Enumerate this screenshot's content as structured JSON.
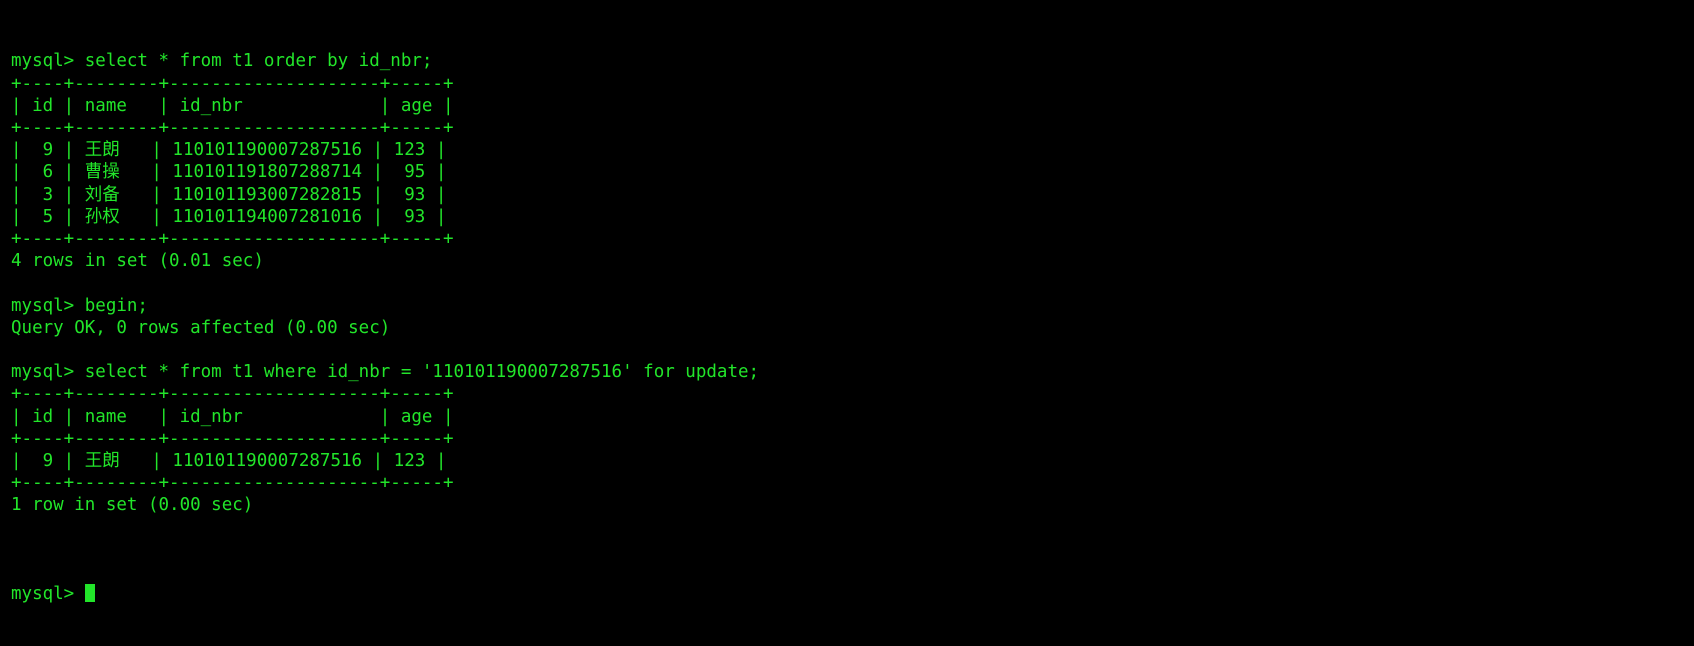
{
  "terminal": {
    "app": "mysql-client",
    "foreground_color": "#22e52a",
    "background_color": "#000000",
    "prompt": "mysql> ",
    "cursor": "block-cursor"
  },
  "lines": [
    {
      "id": "cmd-1",
      "text": "mysql> select * from t1 order by id_nbr;"
    },
    {
      "id": "t1-sep-top",
      "text": "+----+--------+--------------------+-----+"
    },
    {
      "id": "t1-header",
      "text": "| id | name   | id_nbr             | age |"
    },
    {
      "id": "t1-sep-mid",
      "text": "+----+--------+--------------------+-----+"
    },
    {
      "id": "t1-row-1",
      "text": "|  9 | 王朗   | 110101190007287516 | 123 |"
    },
    {
      "id": "t1-row-2",
      "text": "|  6 | 曹操   | 110101191807288714 |  95 |"
    },
    {
      "id": "t1-row-3",
      "text": "|  3 | 刘备   | 110101193007282815 |  93 |"
    },
    {
      "id": "t1-row-4",
      "text": "|  5 | 孙权   | 110101194007281016 |  93 |"
    },
    {
      "id": "t1-sep-bot",
      "text": "+----+--------+--------------------+-----+"
    },
    {
      "id": "t1-status",
      "text": "4 rows in set (0.01 sec)"
    },
    {
      "id": "blank-1",
      "text": ""
    },
    {
      "id": "cmd-2",
      "text": "mysql> begin;"
    },
    {
      "id": "begin-status",
      "text": "Query OK, 0 rows affected (0.00 sec)"
    },
    {
      "id": "blank-2",
      "text": ""
    },
    {
      "id": "cmd-3",
      "text": "mysql> select * from t1 where id_nbr = '110101190007287516' for update;"
    },
    {
      "id": "t2-sep-top",
      "text": "+----+--------+--------------------+-----+"
    },
    {
      "id": "t2-header",
      "text": "| id | name   | id_nbr             | age |"
    },
    {
      "id": "t2-sep-mid",
      "text": "+----+--------+--------------------+-----+"
    },
    {
      "id": "t2-row-1",
      "text": "|  9 | 王朗   | 110101190007287516 | 123 |"
    },
    {
      "id": "t2-sep-bot",
      "text": "+----+--------+--------------------+-----+"
    },
    {
      "id": "t2-status",
      "text": "1 row in set (0.00 sec)"
    },
    {
      "id": "blank-3",
      "text": ""
    }
  ],
  "session": {
    "queries": [
      "select * from t1 order by id_nbr;",
      "begin;",
      "select * from t1 where id_nbr = '110101190007287516' for update;"
    ],
    "table_name": "t1",
    "columns": [
      "id",
      "name",
      "id_nbr",
      "age"
    ],
    "first_result_rows": [
      {
        "id": "9",
        "name": "王朗",
        "id_nbr": "110101190007287516",
        "age": "123"
      },
      {
        "id": "6",
        "name": "曹操",
        "id_nbr": "110101191807288714",
        "age": "95"
      },
      {
        "id": "3",
        "name": "刘备",
        "id_nbr": "110101193007282815",
        "age": "93"
      },
      {
        "id": "5",
        "name": "孙权",
        "id_nbr": "110101194007281016",
        "age": "93"
      }
    ],
    "second_result_rows": [
      {
        "id": "9",
        "name": "王朗",
        "id_nbr": "110101190007287516",
        "age": "123"
      }
    ],
    "first_result_status": "4 rows in set (0.01 sec)",
    "begin_status": "Query OK, 0 rows affected (0.00 sec)",
    "second_result_status": "1 row in set (0.00 sec)"
  }
}
